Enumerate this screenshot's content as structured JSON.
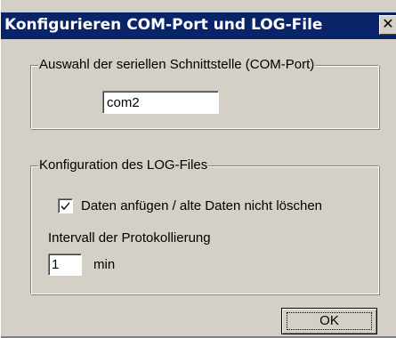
{
  "window": {
    "title": "Konfigurieren COM-Port und LOG-File",
    "close_glyph": "✕"
  },
  "com_group": {
    "label": "Auswahl der seriellen Schnittstelle (COM-Port)",
    "port_value": "com2"
  },
  "log_group": {
    "label": "Konfiguration des LOG-Files",
    "append_checkbox": {
      "label": "Daten anfügen / alte Daten nicht löschen",
      "checked": true
    },
    "interval_label": "Intervall der Protokollierung",
    "interval_value": "1",
    "interval_unit": "min"
  },
  "buttons": {
    "ok_label": "OK"
  },
  "colors": {
    "title_bar": "#0a246a",
    "face": "#d4d0c8",
    "shadow": "#808080",
    "highlight": "#ffffff"
  }
}
